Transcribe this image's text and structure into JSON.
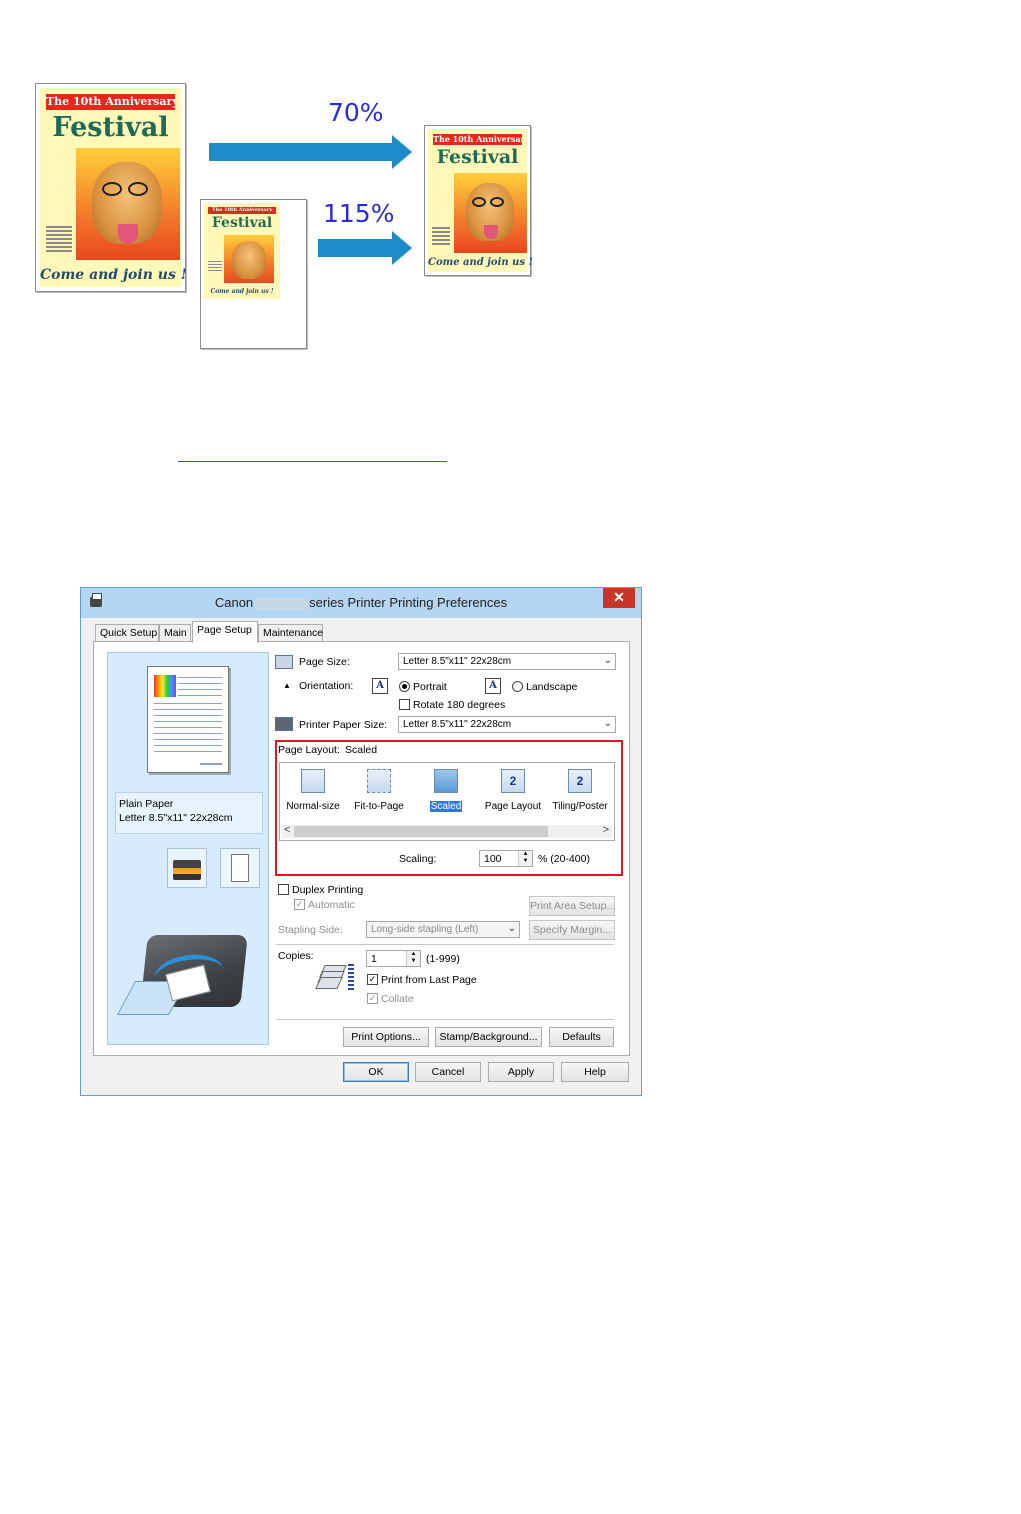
{
  "illustration": {
    "poster": {
      "banner": "The 10th Anniversary",
      "title": "Festival",
      "slogan": "Come and join us !"
    },
    "arrows": [
      {
        "label": "70%"
      },
      {
        "label": "115%"
      }
    ]
  },
  "dialog": {
    "title_prefix": "Canon",
    "title_suffix": "series Printer Printing Preferences",
    "close": "✕",
    "tabs": [
      "Quick Setup",
      "Main",
      "Page Setup",
      "Maintenance"
    ],
    "active_tab": "Page Setup",
    "preview": {
      "paper_type": "Plain Paper",
      "paper_size": "Letter 8.5\"x11\" 22x28cm"
    },
    "page_size": {
      "label": "Page Size:",
      "value": "Letter 8.5\"x11\" 22x28cm"
    },
    "orientation": {
      "label": "Orientation:",
      "portrait": "Portrait",
      "landscape": "Landscape",
      "selected": "Portrait",
      "icon_letter": "A",
      "rotate_label": "Rotate 180 degrees",
      "rotate_checked": false
    },
    "printer_paper_size": {
      "label": "Printer Paper Size:",
      "value": "Letter 8.5\"x11\" 22x28cm"
    },
    "page_layout": {
      "label": "Page Layout:",
      "current": "Scaled",
      "options": [
        {
          "label": "Normal-size",
          "icon": "normal-size-icon"
        },
        {
          "label": "Fit-to-Page",
          "icon": "fit-to-page-icon"
        },
        {
          "label": "Scaled",
          "icon": "scaled-icon",
          "selected": true
        },
        {
          "label": "Page Layout",
          "icon": "page-layout-icon",
          "glyph": "2"
        },
        {
          "label": "Tiling/Poster",
          "icon": "tiling-poster-icon",
          "glyph": "2"
        }
      ],
      "scroll_left": "<",
      "scroll_right": ">"
    },
    "scaling": {
      "label": "Scaling:",
      "value": "100",
      "range": "% (20-400)"
    },
    "duplex": {
      "label": "Duplex Printing",
      "checked": false,
      "automatic_label": "Automatic",
      "automatic_checked": true,
      "print_area_setup": "Print Area Setup..."
    },
    "stapling": {
      "label": "Stapling Side:",
      "value": "Long-side stapling (Left)",
      "specify_margin": "Specify Margin..."
    },
    "copies": {
      "label": "Copies:",
      "value": "1",
      "range": "(1-999)",
      "print_from_last_label": "Print from Last Page",
      "print_from_last_checked": true,
      "collate_label": "Collate",
      "collate_checked": true
    },
    "buttons": {
      "print_options": "Print Options...",
      "stamp_background": "Stamp/Background...",
      "defaults": "Defaults",
      "ok": "OK",
      "cancel": "Cancel",
      "apply": "Apply",
      "help": "Help"
    },
    "colors": {
      "highlight": "#e3161b",
      "titlebar": "#b5d6f2",
      "preview_bg": "#d6ebfb",
      "selection": "#2d7ad6"
    }
  }
}
